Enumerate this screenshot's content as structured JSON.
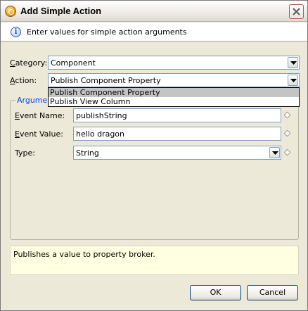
{
  "window": {
    "title": "Add Simple Action"
  },
  "banner": {
    "text": "Enter values for simple action arguments"
  },
  "form": {
    "category": {
      "label_prefix": "C",
      "label_rest": "ategory:",
      "value": "Component"
    },
    "action": {
      "label_prefix": "A",
      "label_rest": "ction:",
      "value": "Publish Component Property"
    }
  },
  "action_dropdown": {
    "options": [
      "Publish Component Property",
      "Publish View Column"
    ],
    "selected_index": 0
  },
  "arguments": {
    "group_title": "Arguments",
    "rows": [
      {
        "label_prefix": "E",
        "label_rest": "vent Name:",
        "value": "publishString"
      },
      {
        "label_prefix": "E",
        "label_rest": "vent Value:",
        "value": "hello dragon"
      },
      {
        "label_prefix": "",
        "label_rest": "Type:",
        "value": "String"
      }
    ]
  },
  "description": {
    "text": "Publishes a value to property broker."
  },
  "buttons": {
    "ok": "OK",
    "cancel": "Cancel"
  },
  "icons": {
    "app": "app-icon",
    "close": "close-icon",
    "info": "info-icon",
    "dropdown": "chevron-down-icon",
    "field_marker": "diamond-icon"
  },
  "colors": {
    "accent": "#0046d5",
    "description_bg": "#ffffe1",
    "selection": "#c4c4c4"
  }
}
